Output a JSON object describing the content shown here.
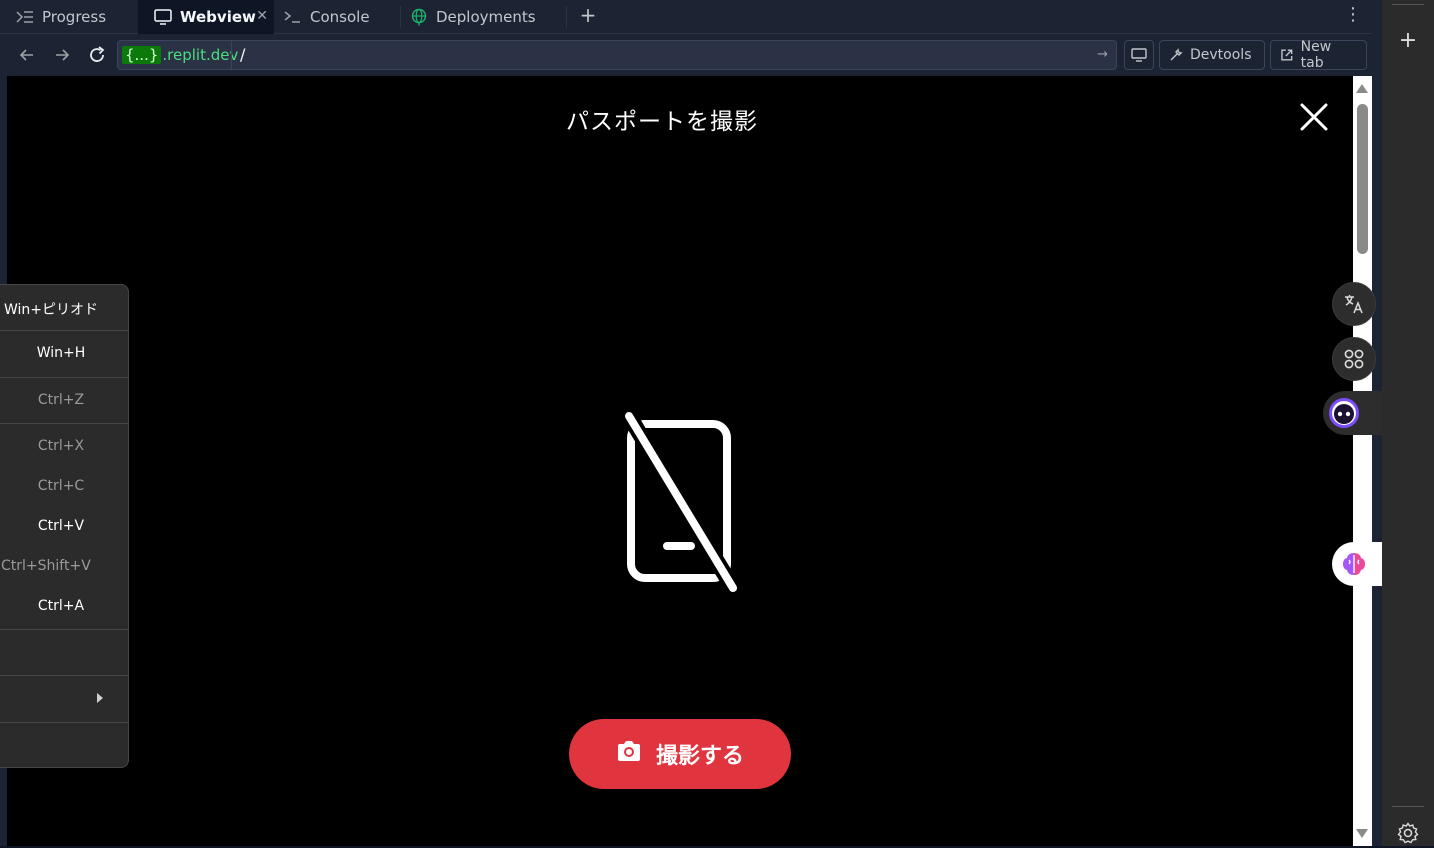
{
  "tabs": [
    {
      "label": "Progress",
      "icon": "progress-icon",
      "active": false
    },
    {
      "label": "Webview",
      "icon": "monitor-icon",
      "active": true
    },
    {
      "label": "Console",
      "icon": "terminal-icon",
      "active": false
    },
    {
      "label": "Deployments",
      "icon": "globe-icon",
      "active": false
    }
  ],
  "urlbar": {
    "domain_brace": "{...}",
    "domain_rest": ".replit.dev",
    "path": "/",
    "devtools_label": "Devtools",
    "newtab_label": "New tab"
  },
  "page": {
    "title": "パスポートを撮影",
    "capture_label": "撮影する",
    "accent_color": "#e0343e"
  },
  "context_menu": {
    "items": [
      {
        "shortcut": "Win+ピリオド",
        "enabled": true
      },
      {
        "shortcut": "Win+H",
        "enabled": true
      },
      {
        "shortcut": "Ctrl+Z",
        "enabled": false
      },
      {
        "shortcut": "Ctrl+X",
        "enabled": false
      },
      {
        "shortcut": "Ctrl+C",
        "enabled": false
      },
      {
        "shortcut": "Ctrl+V",
        "enabled": true
      },
      {
        "shortcut": "Ctrl+Shift+V",
        "enabled": false
      },
      {
        "shortcut": "Ctrl+A",
        "enabled": true
      }
    ]
  },
  "floating_buttons": [
    "translate-icon",
    "apps-icon",
    "assistant-face-icon",
    "brain-icon"
  ]
}
